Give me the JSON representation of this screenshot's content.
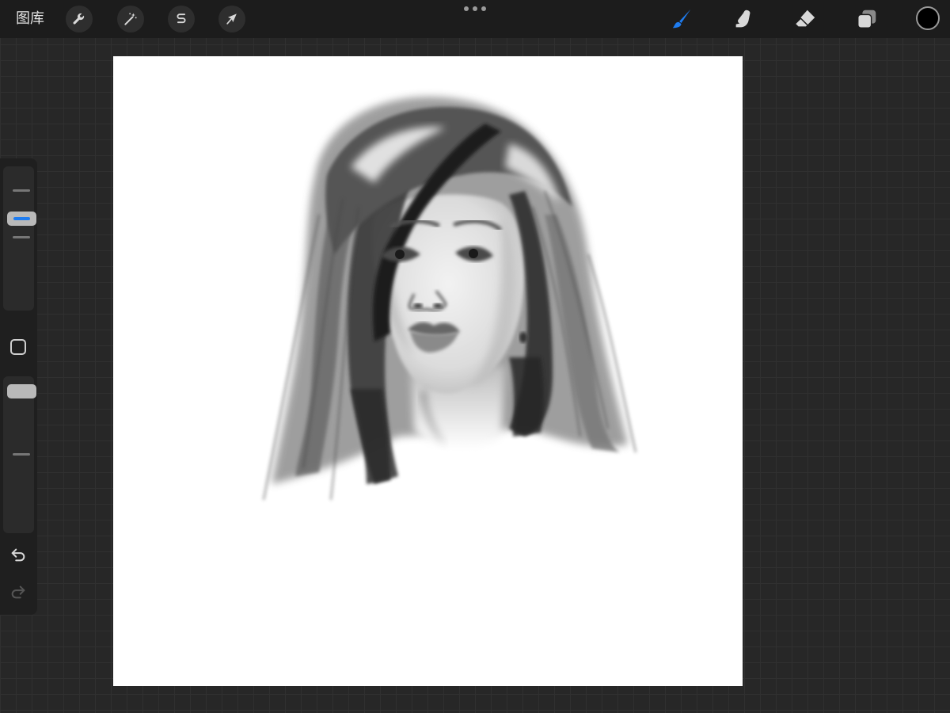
{
  "app": {
    "gallery_label": "图库"
  },
  "toolbar": {
    "left_tools": [
      {
        "name": "actions",
        "icon": "wrench-icon"
      },
      {
        "name": "adjustments",
        "icon": "magic-wand-icon"
      },
      {
        "name": "selection",
        "icon": "selection-s-icon"
      },
      {
        "name": "transform",
        "icon": "arrow-cursor-icon"
      }
    ],
    "more_icon": "more-dots-icon",
    "right_tools": [
      {
        "name": "brush",
        "icon": "brush-icon",
        "active": true
      },
      {
        "name": "smudge",
        "icon": "smudge-finger-icon",
        "active": false
      },
      {
        "name": "eraser",
        "icon": "eraser-icon",
        "active": false
      },
      {
        "name": "layers",
        "icon": "layers-icon",
        "active": false
      }
    ],
    "current_color": "#000000"
  },
  "sidebar": {
    "brush_size": 0.65,
    "brush_opacity": 1.0,
    "modify_icon": "square-modify-icon",
    "undo_icon": "undo-arrow-icon",
    "redo_icon": "redo-arrow-icon"
  },
  "colors": {
    "accent": "#1e7cf0",
    "toolbar_bg": "#1c1c1c",
    "workspace_bg": "#272727",
    "canvas_bg": "#ffffff"
  }
}
